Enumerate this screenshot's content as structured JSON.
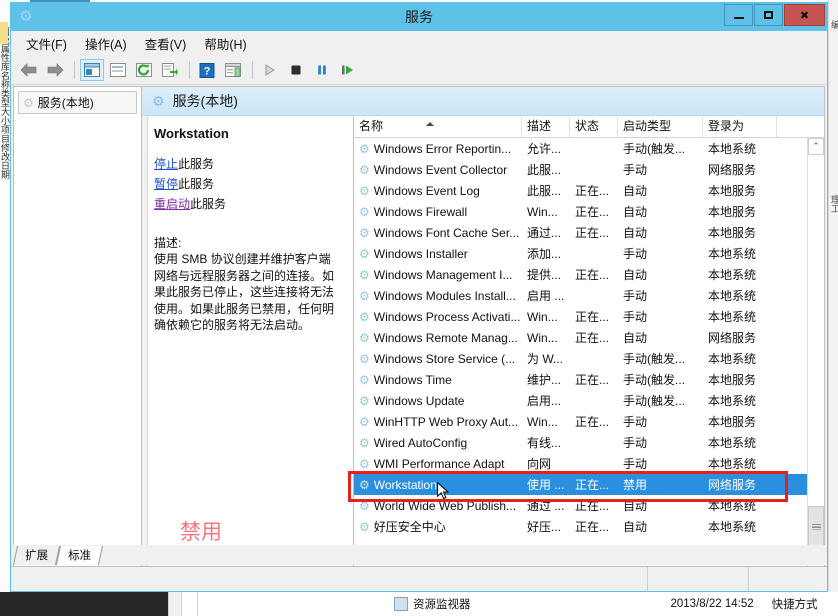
{
  "window": {
    "title": "服务",
    "title_icon": "services-gear-icon",
    "buttons": {
      "minimize": "–",
      "maximize": "□",
      "close": "✕"
    }
  },
  "menubar": {
    "items": [
      {
        "label": "文件(F)",
        "name": "menu-file"
      },
      {
        "label": "操作(A)",
        "name": "menu-action"
      },
      {
        "label": "查看(V)",
        "name": "menu-view"
      },
      {
        "label": "帮助(H)",
        "name": "menu-help"
      }
    ]
  },
  "toolbar": {
    "buttons": [
      {
        "name": "back-button",
        "glyph": "⬅"
      },
      {
        "name": "forward-button",
        "glyph": "➡"
      },
      {
        "name": "show-hide-tree-button",
        "glyph": "▤"
      },
      {
        "name": "properties-button",
        "glyph": "▣"
      },
      {
        "name": "refresh-button",
        "glyph": "⟳"
      },
      {
        "name": "export-list-button",
        "glyph": "⇨"
      },
      {
        "name": "help-button",
        "glyph": "?"
      },
      {
        "name": "show-action-pane-button",
        "glyph": "▥"
      },
      {
        "name": "start-service-button",
        "glyph": "▶"
      },
      {
        "name": "stop-service-button",
        "glyph": "■"
      },
      {
        "name": "pause-service-button",
        "glyph": "❚❚"
      },
      {
        "name": "restart-service-button",
        "glyph": "❚▶"
      }
    ]
  },
  "tree": {
    "root_label": "服务(本地)"
  },
  "pane": {
    "header_title": "服务(本地)"
  },
  "detail": {
    "service_name": "Workstation",
    "links": [
      {
        "link_text": "停止",
        "suffix": "此服务",
        "name": "stop-service-link"
      },
      {
        "link_text": "暂停",
        "suffix": "此服务",
        "name": "pause-service-link"
      },
      {
        "link_text": "重启动",
        "suffix": "此服务",
        "name": "restart-service-link"
      }
    ],
    "description_label": "描述:",
    "description": "使用 SMB 协议创建并维护客户端网络与远程服务器之间的连接。如果此服务已停止，这些连接将无法使用。如果此服务已禁用，任何明确依赖它的服务将无法启动。",
    "annotation": "禁用"
  },
  "list": {
    "columns": [
      {
        "label": "名称",
        "name": "column-name"
      },
      {
        "label": "描述",
        "name": "column-description"
      },
      {
        "label": "状态",
        "name": "column-status"
      },
      {
        "label": "启动类型",
        "name": "column-startup-type"
      },
      {
        "label": "登录为",
        "name": "column-log-on-as"
      }
    ],
    "sort_column": "名称",
    "sort_direction": "asc",
    "rows": [
      {
        "name": "Windows Error Reportin...",
        "desc": "允许...",
        "status": "",
        "startup": "手动(触发...",
        "logon": "本地系统",
        "selected": false
      },
      {
        "name": "Windows Event Collector",
        "desc": "此服...",
        "status": "",
        "startup": "手动",
        "logon": "网络服务",
        "selected": false
      },
      {
        "name": "Windows Event Log",
        "desc": "此服...",
        "status": "正在...",
        "startup": "自动",
        "logon": "本地服务",
        "selected": false
      },
      {
        "name": "Windows Firewall",
        "desc": "Win...",
        "status": "正在...",
        "startup": "自动",
        "logon": "本地服务",
        "selected": false
      },
      {
        "name": "Windows Font Cache Ser...",
        "desc": "通过...",
        "status": "正在...",
        "startup": "自动",
        "logon": "本地服务",
        "selected": false
      },
      {
        "name": "Windows Installer",
        "desc": "添加...",
        "status": "",
        "startup": "手动",
        "logon": "本地系统",
        "selected": false
      },
      {
        "name": "Windows Management I...",
        "desc": "提供...",
        "status": "正在...",
        "startup": "自动",
        "logon": "本地系统",
        "selected": false
      },
      {
        "name": "Windows Modules Install...",
        "desc": "启用 ...",
        "status": "",
        "startup": "手动",
        "logon": "本地系统",
        "selected": false
      },
      {
        "name": "Windows Process Activati...",
        "desc": "Win...",
        "status": "正在...",
        "startup": "手动",
        "logon": "本地系统",
        "selected": false
      },
      {
        "name": "Windows Remote Manag...",
        "desc": "Win...",
        "status": "正在...",
        "startup": "自动",
        "logon": "网络服务",
        "selected": false
      },
      {
        "name": "Windows Store Service (...",
        "desc": "为 W...",
        "status": "",
        "startup": "手动(触发...",
        "logon": "本地系统",
        "selected": false
      },
      {
        "name": "Windows Time",
        "desc": "维护...",
        "status": "正在...",
        "startup": "手动(触发...",
        "logon": "本地服务",
        "selected": false
      },
      {
        "name": "Windows Update",
        "desc": "启用...",
        "status": "",
        "startup": "手动(触发...",
        "logon": "本地系统",
        "selected": false
      },
      {
        "name": "WinHTTP Web Proxy Aut...",
        "desc": "Win...",
        "status": "正在...",
        "startup": "手动",
        "logon": "本地服务",
        "selected": false
      },
      {
        "name": "Wired AutoConfig",
        "desc": "有线...",
        "status": "",
        "startup": "手动",
        "logon": "本地系统",
        "selected": false
      },
      {
        "name": "WMI Performance Adapt",
        "desc": "向网",
        "status": "",
        "startup": "手动",
        "logon": "本地系统",
        "selected": false
      },
      {
        "name": "Workstation",
        "desc": "使用 ...",
        "status": "正在...",
        "startup": "禁用",
        "logon": "网络服务",
        "selected": true
      },
      {
        "name": "World Wide Web Publish...",
        "desc": "通过 ...",
        "status": "正在...",
        "startup": "自动",
        "logon": "本地系统",
        "selected": false
      },
      {
        "name": "好压安全中心",
        "desc": "好压...",
        "status": "正在...",
        "startup": "自动",
        "logon": "本地系统",
        "selected": false
      }
    ],
    "scrollbar": {
      "up_glyph": "⌃",
      "down_glyph": "⌄"
    }
  },
  "tabs": [
    {
      "label": "扩展",
      "active": false,
      "name": "tab-extended"
    },
    {
      "label": "标准",
      "active": true,
      "name": "tab-standard"
    }
  ],
  "taskbar": {
    "item_label": "资源监视器",
    "clock": "2013/8/22 14:52",
    "hint": "快捷方式"
  },
  "background": {
    "left_strip_text": "面板属性库名称类型大小项目修改日期",
    "right_label_top": "编",
    "right_label_mid": "理工"
  },
  "colors": {
    "titlebar": "#5ec2e8",
    "close_button": "#c75450",
    "selection": "#2b8fe0",
    "annotation_red": "#e8201a",
    "annotation_text": "#f4777c",
    "link_blue": "#1a4fd0",
    "link_visited": "#7b2fa0"
  }
}
